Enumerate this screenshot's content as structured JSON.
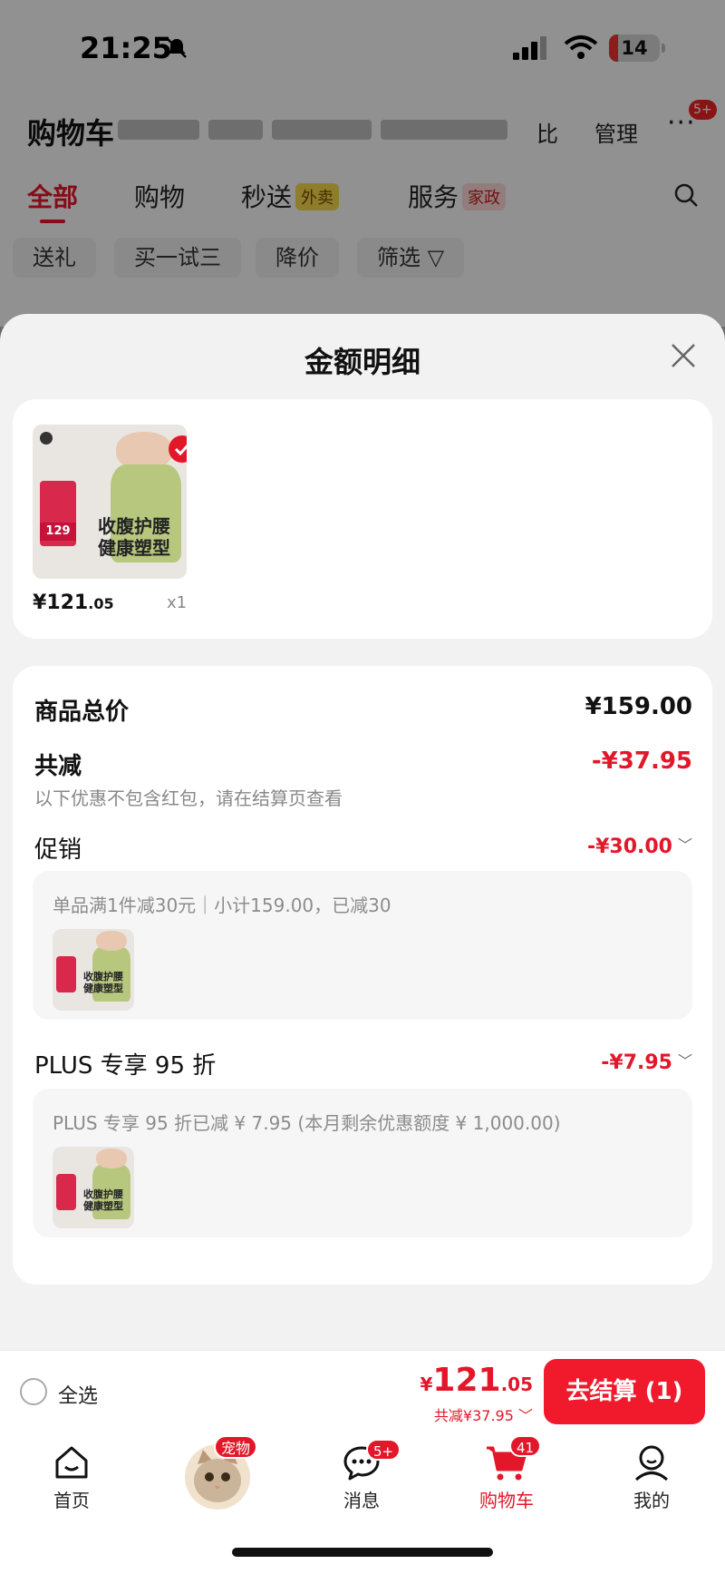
{
  "status_bar": {
    "time": "21:25",
    "battery": "14"
  },
  "background": {
    "title": "购物车",
    "compare_label": "比",
    "manage_label": "管理",
    "more_icon": "more-dots-icon",
    "more_badge": "5+",
    "tabs": [
      {
        "label": "全部",
        "chip": "",
        "active": true
      },
      {
        "label": "购物",
        "chip": ""
      },
      {
        "label": "秒送",
        "chip": "外卖"
      },
      {
        "label": "服务",
        "chip": "家政"
      }
    ],
    "filters": [
      "送礼",
      "买一试三",
      "降价",
      "筛选"
    ]
  },
  "sheet": {
    "title": "金额明细",
    "product": {
      "slogan_line1": "收腹护腰",
      "slogan_line2": "健康塑型",
      "card_price": "129",
      "price_yen": "¥",
      "price_int": "121",
      "price_dec": ".05",
      "qty": "x1"
    },
    "summary": {
      "total_label": "商品总价",
      "total_value": "¥159.00",
      "discount_label": "共减",
      "discount_value": "-¥37.95",
      "discount_note": "以下优惠不包含红包，请在结算页查看",
      "promo_label": "促销",
      "promo_value": "-¥30.00",
      "promo_desc": "单品满1件减30元｜小计159.00，已减30",
      "plus_label": "PLUS 专享 95 折",
      "plus_value": "-¥7.95",
      "plus_desc": "PLUS 专享 95 折已减 ¥ 7.95 (本月剩余优惠额度 ¥ 1,000.00)"
    }
  },
  "checkout": {
    "select_all_label": "全选",
    "total_yen": "¥",
    "total_int": "121",
    "total_dec": ".05",
    "total_discount": "共减¥37.95",
    "pay_button": "去结算 (1)"
  },
  "tabbar": {
    "items": [
      {
        "label": "首页",
        "icon": "home-icon"
      },
      {
        "label": "",
        "icon": "pet-avatar",
        "badge": "宠物"
      },
      {
        "label": "消息",
        "icon": "message-icon",
        "badge": "5+"
      },
      {
        "label": "购物车",
        "icon": "cart-icon",
        "badge": "41",
        "active": true
      },
      {
        "label": "我的",
        "icon": "profile-icon"
      }
    ]
  },
  "colors": {
    "accent": "#e3172a",
    "sheet_bg": "#f2f2f2",
    "card_bg": "#ffffff"
  }
}
